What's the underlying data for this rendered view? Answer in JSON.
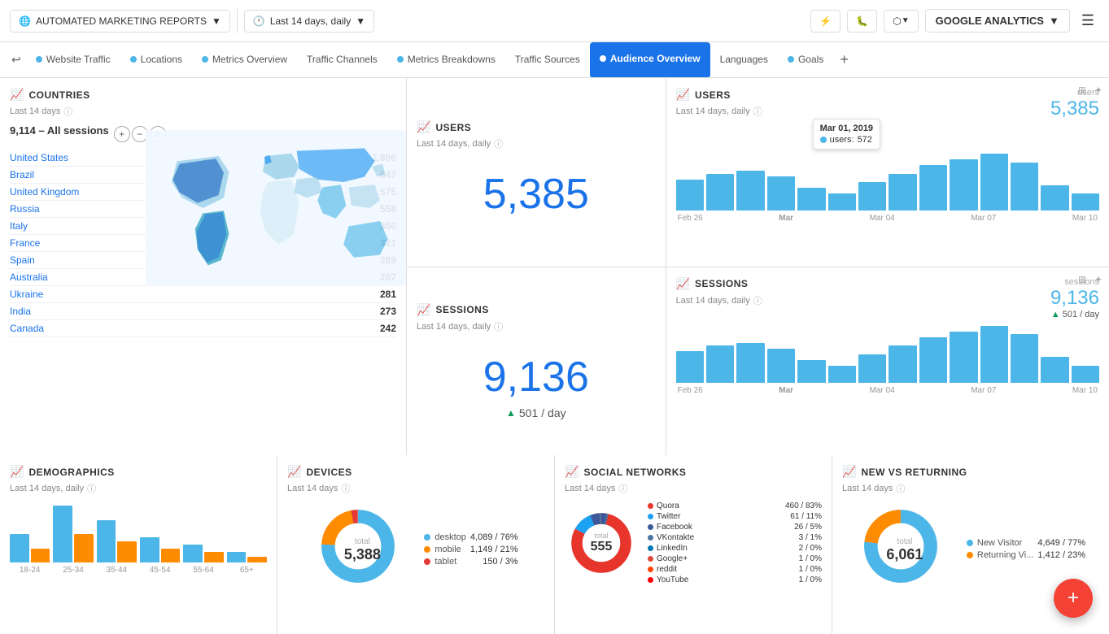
{
  "header": {
    "report_title": "AUTOMATED MARKETING REPORTS",
    "date_range": "Last 14 days, daily",
    "ga_label": "GOOGLE ANALYTICS"
  },
  "nav": {
    "back_arrow": "↩",
    "tabs": [
      {
        "label": "Website Traffic",
        "dot_color": "#4db6e8",
        "active": false
      },
      {
        "label": "Locations",
        "dot_color": "#4db6e8",
        "active": false
      },
      {
        "label": "Metrics Overview",
        "dot_color": "#4db6e8",
        "active": false
      },
      {
        "label": "Traffic Channels",
        "dot_color": "#4db6e8",
        "active": false
      },
      {
        "label": "Metrics Breakdowns",
        "dot_color": "#4db6e8",
        "active": false
      },
      {
        "label": "Traffic Sources",
        "dot_color": "#4db6e8",
        "active": false
      },
      {
        "label": "Audience Overview",
        "dot_color": "#fff",
        "active": true
      },
      {
        "label": "Languages",
        "dot_color": null,
        "active": false
      },
      {
        "label": "Goals",
        "dot_color": "#4db6e8",
        "active": false
      }
    ],
    "add_icon": "+"
  },
  "countries": {
    "title": "COUNTRIES",
    "subtitle": "Last 14 days",
    "total": "9,114",
    "total_label": "– All sessions",
    "items": [
      {
        "name": "United States",
        "count": "1,896"
      },
      {
        "name": "Brazil",
        "count": "647"
      },
      {
        "name": "United Kingdom",
        "count": "575"
      },
      {
        "name": "Russia",
        "count": "558"
      },
      {
        "name": "Italy",
        "count": "350"
      },
      {
        "name": "France",
        "count": "321"
      },
      {
        "name": "Spain",
        "count": "289"
      },
      {
        "name": "Australia",
        "count": "287"
      },
      {
        "name": "Ukraine",
        "count": "281"
      },
      {
        "name": "India",
        "count": "273"
      },
      {
        "name": "Canada",
        "count": "242"
      }
    ]
  },
  "users_metric": {
    "title": "USERS",
    "subtitle": "Last 14 days, daily",
    "value": "5,385"
  },
  "users_chart": {
    "title": "USERS",
    "subtitle": "Last 14 days, daily",
    "label": "users",
    "value": "5,385",
    "tooltip": {
      "date": "Mar 01, 2019",
      "metric": "users:",
      "count": "572"
    },
    "x_labels": [
      "Feb 26",
      "Mar",
      "Mar 04",
      "Mar 07",
      "Mar 10"
    ],
    "bars": [
      55,
      65,
      70,
      60,
      40,
      30,
      50,
      65,
      80,
      90,
      100,
      85,
      45,
      30
    ]
  },
  "sessions_metric": {
    "title": "SESSIONS",
    "subtitle": "Last 14 days, daily",
    "value": "9,136",
    "sub_value": "501",
    "sub_label": "/ day"
  },
  "sessions_chart": {
    "title": "SESSIONS",
    "subtitle": "Last 14 days, daily",
    "label": "sessions",
    "value": "9,136",
    "sub": "▲501 / day",
    "x_labels": [
      "Feb 26",
      "Mar",
      "Mar 04",
      "Mar 07",
      "Mar 10"
    ],
    "bars": [
      55,
      65,
      70,
      60,
      40,
      30,
      50,
      65,
      80,
      90,
      100,
      85,
      45,
      30
    ]
  },
  "demographics": {
    "title": "DEMOGRAPHICS",
    "subtitle": "Last 14 days, daily",
    "x_labels": [
      "18-24",
      "25-34",
      "35-44",
      "45-54",
      "55-64",
      "65+"
    ],
    "blue_bars": [
      40,
      80,
      60,
      35,
      25,
      15
    ],
    "orange_bars": [
      20,
      40,
      30,
      20,
      15,
      8
    ]
  },
  "devices": {
    "title": "DEVICES",
    "subtitle": "Last 14 days",
    "total_label": "total",
    "total": "5,388",
    "legend": [
      {
        "name": "desktop",
        "color": "#4db6e8",
        "value": "4,089",
        "pct": "76%"
      },
      {
        "name": "mobile",
        "color": "#ff8c00",
        "value": "1,149",
        "pct": "21%"
      },
      {
        "name": "tablet",
        "color": "#e53935",
        "value": "150",
        "pct": "3%"
      }
    ],
    "donut_data": [
      76,
      21,
      3
    ],
    "donut_colors": [
      "#4db6e8",
      "#ff8c00",
      "#e53935"
    ]
  },
  "social_networks": {
    "title": "SOCIAL NETWORKS",
    "subtitle": "Last 14 days",
    "total_label": "total",
    "total": "555",
    "items": [
      {
        "name": "Quora",
        "color": "#e8352b",
        "value": "460",
        "pct": "83%"
      },
      {
        "name": "Twitter",
        "color": "#1da1f2",
        "value": "61",
        "pct": "11%"
      },
      {
        "name": "Facebook",
        "color": "#3b5998",
        "value": "26",
        "pct": "5%"
      },
      {
        "name": "VKontakte",
        "color": "#4c75a3",
        "value": "3",
        "pct": "1%"
      },
      {
        "name": "LinkedIn",
        "color": "#0077b5",
        "value": "2",
        "pct": "0%"
      },
      {
        "name": "Google+",
        "color": "#dd4b39",
        "value": "1",
        "pct": "0%"
      },
      {
        "name": "reddit",
        "color": "#ff4500",
        "value": "1",
        "pct": "0%"
      },
      {
        "name": "YouTube",
        "color": "#ff0000",
        "value": "1",
        "pct": "0%"
      }
    ]
  },
  "new_vs_returning": {
    "title": "NEW VS RETURNING",
    "subtitle": "Last 14 days",
    "total_label": "total",
    "total": "6,061",
    "legend": [
      {
        "name": "New Visitor",
        "color": "#4db6e8",
        "value": "4,649",
        "pct": "77%"
      },
      {
        "name": "Returning Vi...",
        "color": "#ff8c00",
        "value": "1,412",
        "pct": "23%"
      }
    ],
    "donut_data": [
      77,
      23
    ],
    "donut_colors": [
      "#4db6e8",
      "#ff8c00"
    ]
  },
  "icons": {
    "globe": "🌐",
    "clock": "🕐",
    "flash": "⚡",
    "bug": "🐛",
    "share": "⬡",
    "menu": "☰",
    "chart": "📈",
    "gear": "⚙",
    "expand": "⊞",
    "info": "ⓘ",
    "fab_plus": "+"
  },
  "colors": {
    "primary_blue": "#1a73e8",
    "chart_blue": "#4db6e8",
    "orange": "#ff8c00",
    "green": "#0f9d58",
    "red": "#e53935",
    "active_tab_bg": "#1a73e8",
    "active_tab_text": "#fff"
  }
}
